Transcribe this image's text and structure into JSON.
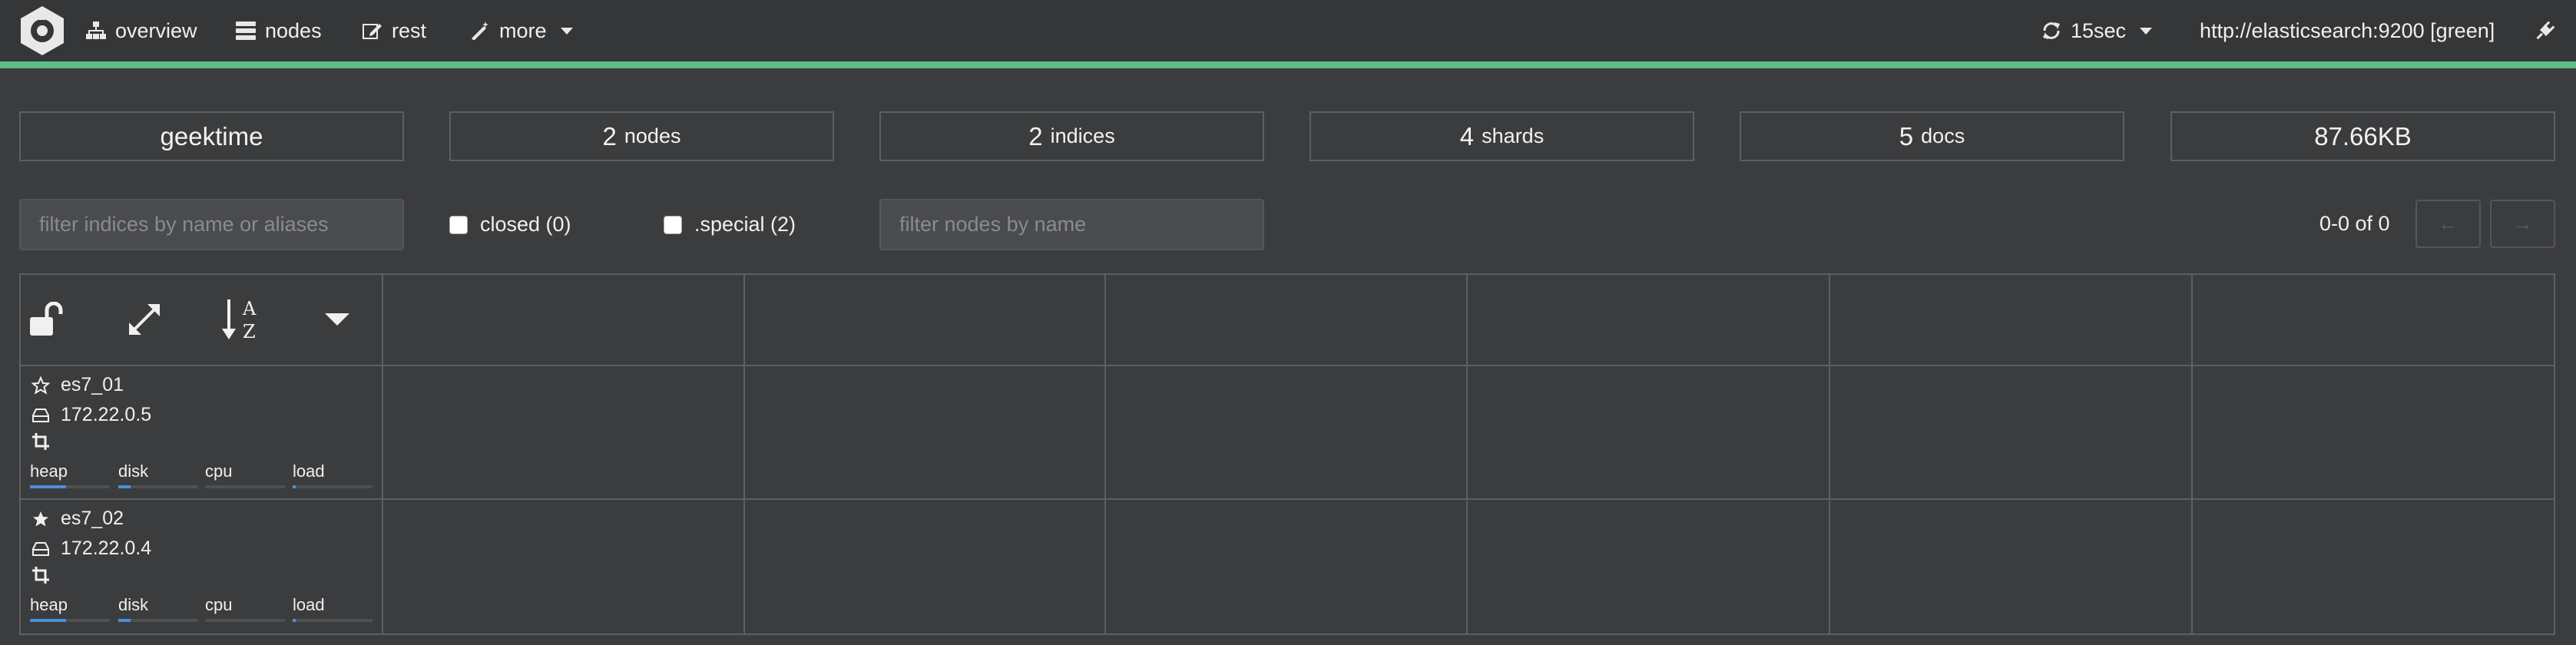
{
  "nav": {
    "items": [
      {
        "label": "overview",
        "icon": "sitemap-icon"
      },
      {
        "label": "nodes",
        "icon": "server-icon"
      },
      {
        "label": "rest",
        "icon": "edit-icon"
      },
      {
        "label": "more",
        "icon": "magic-wand-icon"
      }
    ],
    "refresh_label": "15sec",
    "cluster_url": "http://elasticsearch:9200 [green]",
    "accent_color": "#5cbc8a"
  },
  "stats": {
    "cluster_name": "geektime",
    "nodes": {
      "num": "2",
      "label": "nodes"
    },
    "indices": {
      "num": "2",
      "label": "indices"
    },
    "shards": {
      "num": "4",
      "label": "shards"
    },
    "docs": {
      "num": "5",
      "label": "docs"
    },
    "size": "87.66KB"
  },
  "filters": {
    "indices_placeholder": "filter indices by name or aliases",
    "closed_label": "closed (0)",
    "special_label": ".special (2)",
    "nodes_placeholder": "filter nodes by name",
    "pager_text": "0-0 of 0",
    "prev_label": "←",
    "next_label": "→"
  },
  "toolbar_icons": [
    "unlock-icon",
    "expand-icon",
    "sort-alpha-icon",
    "caret-down-icon"
  ],
  "nodes": [
    {
      "name": "es7_01",
      "ip": "172.22.0.5",
      "master": false,
      "metrics": [
        {
          "label": "heap",
          "fill": 0.45
        },
        {
          "label": "disk",
          "fill": 0.15
        },
        {
          "label": "cpu",
          "fill": 0.0
        },
        {
          "label": "load",
          "fill": 0.04
        }
      ]
    },
    {
      "name": "es7_02",
      "ip": "172.22.0.4",
      "master": true,
      "metrics": [
        {
          "label": "heap",
          "fill": 0.45
        },
        {
          "label": "disk",
          "fill": 0.15
        },
        {
          "label": "cpu",
          "fill": 0.0
        },
        {
          "label": "load",
          "fill": 0.04
        }
      ]
    }
  ]
}
